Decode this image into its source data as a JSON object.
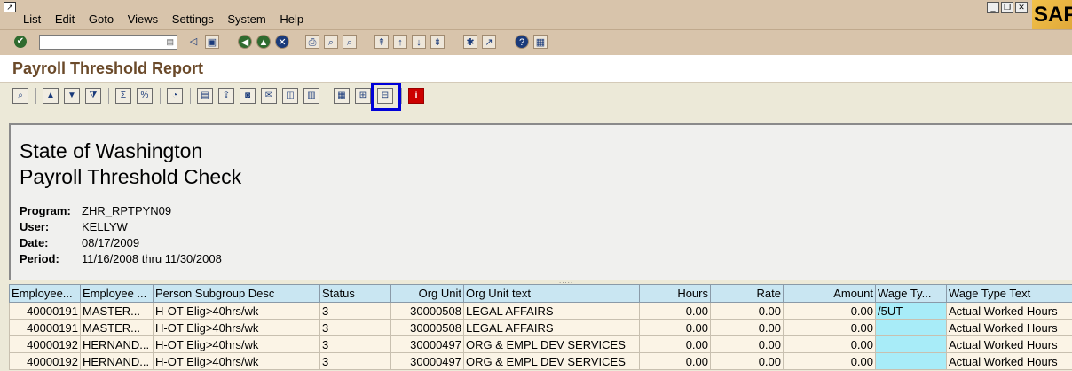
{
  "menubar": {
    "items": [
      "List",
      "Edit",
      "Goto",
      "Views",
      "Settings",
      "System",
      "Help"
    ]
  },
  "brand": {
    "logo": "SAP"
  },
  "screen": {
    "title": "Payroll Threshold Report"
  },
  "report_header": {
    "line1": "State of Washington",
    "line2": "Payroll Threshold Check",
    "program_label": "Program:",
    "program": "ZHR_RPTPYN09",
    "user_label": "User:",
    "user": "KELLYW",
    "date_label": "Date:",
    "date": "08/17/2009",
    "period_label": "Period:",
    "period": "11/16/2008 thru 11/30/2008"
  },
  "grid": {
    "columns": [
      "Employee...",
      "Employee ...",
      "Person Subgroup Desc",
      "Status",
      "Org Unit",
      "Org Unit text",
      "Hours",
      "Rate",
      "Amount",
      "Wage Ty...",
      "Wage Type Text"
    ],
    "rows": [
      [
        "40000191",
        "MASTER...",
        "H-OT Elig>40hrs/wk",
        "3",
        "30000508",
        "LEGAL AFFAIRS",
        "0.00",
        "0.00",
        "0.00",
        "/5UT",
        "Actual Worked Hours"
      ],
      [
        "40000191",
        "MASTER...",
        "H-OT Elig>40hrs/wk",
        "3",
        "30000508",
        "LEGAL AFFAIRS",
        "0.00",
        "0.00",
        "0.00",
        "",
        "Actual Worked Hours"
      ],
      [
        "40000192",
        "HERNAND...",
        "H-OT Elig>40hrs/wk",
        "3",
        "30000497",
        "ORG & EMPL DEV SERVICES",
        "0.00",
        "0.00",
        "0.00",
        "",
        "Actual Worked Hours"
      ],
      [
        "40000192",
        "HERNAND...",
        "H-OT Elig>40hrs/wk",
        "3",
        "30000497",
        "ORG & EMPL DEV SERVICES",
        "0.00",
        "0.00",
        "0.00",
        "",
        "Actual Worked Hours"
      ]
    ]
  },
  "colors": {
    "header_bar": "#d8c4ab",
    "title_text": "#6b4a2a",
    "highlight_border": "#0000d8",
    "grid_header": "#c9e6f2",
    "wage_type_cell": "#a8ecf8"
  }
}
